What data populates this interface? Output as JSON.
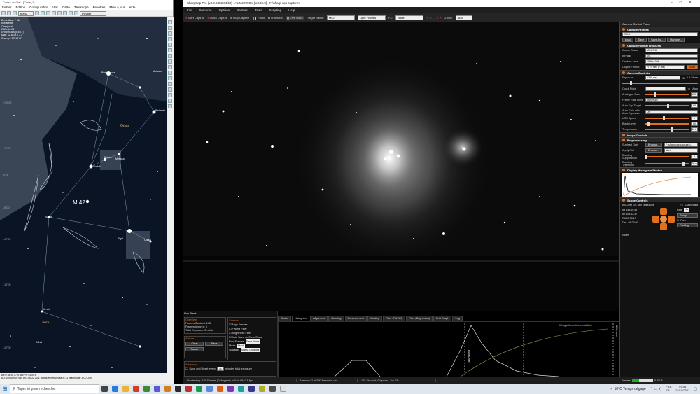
{
  "left_app": {
    "title": "Cartes du Ciel - [Carte_1]",
    "menu": [
      "Fichier",
      "Edition",
      "Configuration",
      "Voir",
      "Carte",
      "Télescope",
      "Fenêtres",
      "Mise à jour",
      "Aide"
    ],
    "toolbar_select": "Pleiade",
    "toolbar_zoom": "mag2",
    "info": [
      "Zenit: Altaz 7 ft6",
      "Apparente",
      "Cheq' mal",
      "2021-10-24",
      "07h49m38s (CEST)",
      "Mag: 12.8/13.0 3.3'",
      "Champ:+10°19'47\""
    ],
    "labels": {
      "m42": "M 42",
      "orion": "Orion",
      "betelgeuse": "Betelgeuse",
      "meissa": "Meissa",
      "bellatrix": "Bellatrix",
      "alnitak": "Alnitak",
      "alnilam": "Alnilam",
      "mintaka": "Mintaka",
      "saiph": "Saiph",
      "rigel": "Rigel",
      "cursa": "Cursa",
      "lepus": "Lièvre",
      "nihal": "Nihal",
      "arneb": "Arneb"
    },
    "ticks": [
      "+10°00'",
      "+5°00'",
      "0°00'",
      "-5°00'",
      "-10°00'",
      "-15°00'",
      "-20°00'"
    ],
    "status_lines": [
      "Az=+78°54'47.4\" Alt=+5°52'09.5\"",
      "AD: 05h35m29.96s DE:-05°22'23.1\" Amas et nébuleuse M 42 Magnitude: 4.00 Dim"
    ]
  },
  "sharpcap": {
    "title": "SharpCap Pro (v4.0.8452 64 bit) - ALTAIR290M [USB2.0] - F:\\sharp cap captures",
    "menu": [
      "File",
      "Cameras",
      "Options",
      "Capture",
      "Tools",
      "Scripting",
      "Help"
    ],
    "toolbar": {
      "start": "Start Capture",
      "quick": "Quick Capture",
      "stop": "Stop Capture",
      "pause": "Pause",
      "snapshot": "Snapshot",
      "live": "Live Stack",
      "target_label": "Target Name:",
      "target_value": "M42",
      "frames": "Light Frames",
      "fx_label": "FX:",
      "fx_value": "None",
      "zoom_label": "Zoom:",
      "zoom_value": "Auto"
    },
    "ccp": {
      "header": "Camera Control Panel",
      "profiles": {
        "title": "Capture Profiles",
        "value": "2304f",
        "load": "Load",
        "save": "Save",
        "save_as": "Save As...",
        "manage": "Manage..."
      },
      "format": {
        "title": "Capture Format and Area",
        "colour_label": "Colour Space",
        "colour": "MONO12",
        "binning_label": "Binning",
        "binning": "1x1",
        "area_label": "Capture Area",
        "area": "1936x1096",
        "output_label": "Output Format",
        "output": "FITS files (*.fits)",
        "auto": "Auto"
      },
      "controls": {
        "title": "Camera Controls",
        "exposure_label": "Exposure",
        "exposure": "1250 ms",
        "lx": "LX Mode",
        "quick_picks": "Quick Picks",
        "auto": "Auto",
        "gain_label": "Analogue Gain",
        "gain": "200",
        "frame_rate_label": "Frame Rate Limit",
        "frame_rate": "Maximum",
        "auto_exp_label": "Auto Exp Target",
        "auto_exp": "128",
        "auto_gain_label": "Auto Gain with Auto Exposure",
        "auto_gain": "Off",
        "usb_label": "USB Speed",
        "usb": "1",
        "black_label": "Black Level",
        "black": "50",
        "temp_label": "Temperature",
        "temp": "11.2"
      },
      "image_controls": "Image Controls",
      "preproc": {
        "title": "Preprocessing",
        "dark_label": "Subtract Dark",
        "dark_browse": "Browse...",
        "dark": "F:\\sharp cap captures\\...",
        "flat_label": "Apply Flat",
        "flat_browse": "Browse...",
        "flat": "None",
        "band_sup_label": "Banding Suppression",
        "band_sup": "0",
        "band_thr_label": "Banding Threshold",
        "band_thr": "35.0"
      },
      "histo": "Display Histogram Stretch",
      "scope": {
        "title": "Scope Controls",
        "device": "ASCOM GS Sky Telescope",
        "connected": "Connected",
        "rate_label": "Rate",
        "rate": "16x",
        "az": "Az  159:10:49",
        "alt": "Alt  104:12:37",
        "ra": "RA  05:35:17",
        "dec": "Dec  -05:23:00",
        "setup": "Setup",
        "park": "Park",
        "parking": "Parking",
        "notes": "Notes"
      }
    },
    "live": {
      "title": "Live Stack",
      "overview": "Overview",
      "stacked": "Frames Stacked: 178",
      "ignored": "Frames Ignored: 0",
      "total": "Total Exposure: 3m 43s",
      "actions": "Actions",
      "clear": "Clear",
      "save": "Save",
      "pause": "Pause",
      "controls": "Controls",
      "align": "Align Frames",
      "fwhm": "FWHM Filter",
      "bright": "Brightness Filter",
      "autosave": "Auto Save on Clear/Close",
      "raw_label": "Raw Frames",
      "raw": "Save None",
      "mode_label": "Mode",
      "mode": "Stack",
      "stacking_label": "Stacking",
      "stacking": "Sigma Clipping",
      "advanced": "Advanced",
      "save_reset": "Save and Reset every",
      "minutes": "15",
      "minutes_label": "minutes total exposure"
    },
    "tabs": [
      "Status",
      "Histogram",
      "Alignment",
      "Stacking",
      "Enhancement",
      "Guiding",
      "Filter (FWHM)",
      "Filter (Brightness)",
      "Drift Graph",
      "Log"
    ],
    "log_label": "Logarithmic Horizontal Axis",
    "black_level_marker": "Black Level",
    "white_level_marker": "White Level",
    "status": [
      "Previewing : 150 Frames (0 dropped) in 0:04:05, 0.6 fps",
      "Memory: 2 of 250 frames in use.",
      "178 Stacked, 0 Ignored, 3m 43s",
      "Frames",
      "0.8/0.5"
    ]
  },
  "taskbar": {
    "search": "Taper ici pour rechercher",
    "weather": "10°C  Temps dégagé",
    "lang": "FRA",
    "lang2": "FR",
    "time": "07:48",
    "date": "24/10/2021"
  },
  "colors": {
    "accent": "#e07020",
    "starfield": "#0a1424"
  }
}
